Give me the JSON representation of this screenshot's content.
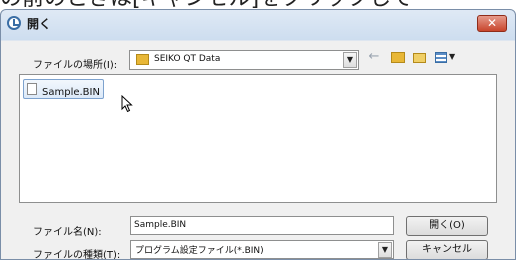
{
  "top_text": "の前のときは[キャンセル]をクリックして",
  "dialog": {
    "title": "開く",
    "close_label": "✕"
  },
  "lookin": {
    "label": "ファイルの場所(I):",
    "value": "SEIKO QT Data",
    "arrow": "▼"
  },
  "toolbar": {
    "back": "←"
  },
  "files": [
    {
      "name": "Sample.BIN"
    }
  ],
  "filename": {
    "label": "ファイル名(N):",
    "value": "Sample.BIN"
  },
  "filetype": {
    "label": "ファイルの種類(T):",
    "value": "プログラム設定ファイル(*.BIN)",
    "arrow": "▼"
  },
  "buttons": {
    "open": "開く(O)",
    "cancel": "キャンセル"
  }
}
